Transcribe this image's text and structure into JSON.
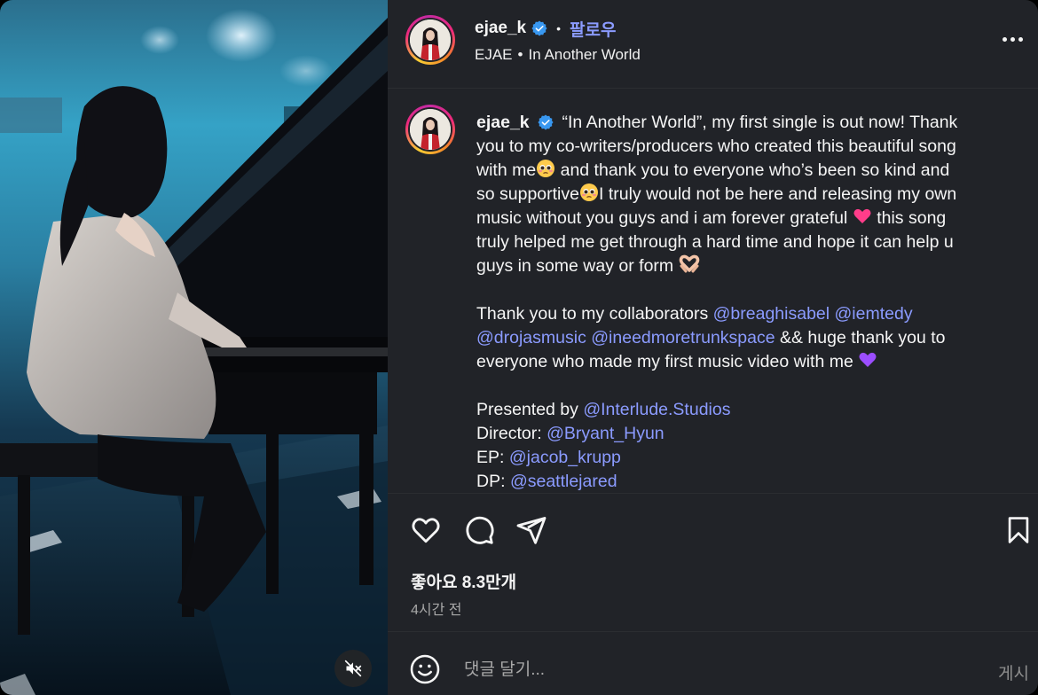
{
  "media": {
    "mute_icon": "speaker-muted-icon"
  },
  "header": {
    "username": "ejae_k",
    "verified_icon": "verified-badge-icon",
    "separator": "•",
    "follow_label": "팔로우",
    "subtitle_artist": "EJAE",
    "subtitle_sep": "•",
    "subtitle_song": "In Another World",
    "more_icon": "more-options-icon"
  },
  "caption": {
    "username": "ejae_k",
    "l1": "“In Another World”, my first single is out now! Thank",
    "l2": "you to my co-writers/producers who created this beautiful song",
    "l3a": "with me",
    "l3b": " and thank you to everyone who’s been so kind and",
    "l4a": "so supportive",
    "l4b": "I truly would not be here and releasing my own",
    "l5a": "music without you guys and i am forever grateful ",
    "l5b": " this song",
    "l6": "truly helped me get through a hard time and hope it can help u",
    "l7": "guys in some way or form ",
    "p2_l1": "Thank you to my collaborators ",
    "m_breaghisabel": "@breaghisabel",
    "m_iemtedy": "@iemtedy",
    "m_drojasmusic": "@drojasmusic",
    "m_ineedmoretrunkspace": "@ineedmoretrunkspace",
    "p2_l2_tail": " && huge thank you to",
    "p2_l3": "everyone who made my first music video with me ",
    "presented_label": "Presented by ",
    "m_interlude": "@Interlude.Studios",
    "director_label": "Director: ",
    "m_bryant": "@Bryant_Hyun",
    "ep_label": "EP: ",
    "m_jacob": "@jacob_krupp",
    "dp_label": "DP: ",
    "m_seattle": "@seattlejared",
    "emojis": [
      "pleading-face-emoji",
      "pink-heart-emoji",
      "heart-hands-emoji",
      "purple-heart-emoji"
    ]
  },
  "actions": {
    "like_icon": "heart-icon",
    "comment_icon": "comment-icon",
    "share_icon": "share-icon",
    "save_icon": "bookmark-icon"
  },
  "likes_text": "좋아요 8.3만개",
  "time_text": "4시간 전",
  "comment": {
    "emoji_icon": "smiley-icon",
    "placeholder": "댓글 달기...",
    "post_label": "게시"
  },
  "colors": {
    "panel_bg": "#212328",
    "link": "#8b9bff",
    "verified": "#3897f0",
    "muted_text": "#a8a8a8"
  }
}
